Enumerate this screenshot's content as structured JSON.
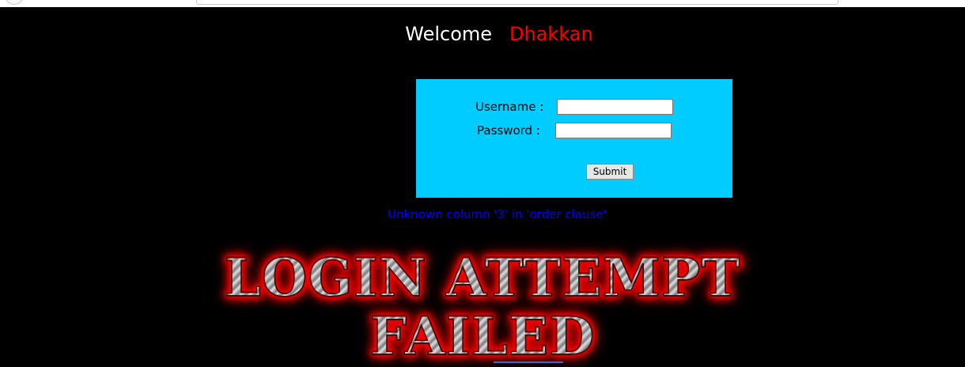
{
  "header": {
    "welcome_text": "Welcome",
    "name_text": "Dhakkan"
  },
  "login_form": {
    "username_label": "Username :",
    "username_value": "",
    "password_label": "Password :",
    "password_value": "",
    "submit_label": "Submit"
  },
  "error": {
    "message": "Unknown column '3' in 'order clause'"
  },
  "banner": {
    "line1": "LOGIN ATTEMPT",
    "line2": "FAILED"
  },
  "colors": {
    "background": "#000000",
    "welcome_text": "#ffffff",
    "name_text": "#ff0000",
    "form_background": "#00ccff",
    "error_text": "#0000ff",
    "banner_glow": "#ff0000"
  }
}
